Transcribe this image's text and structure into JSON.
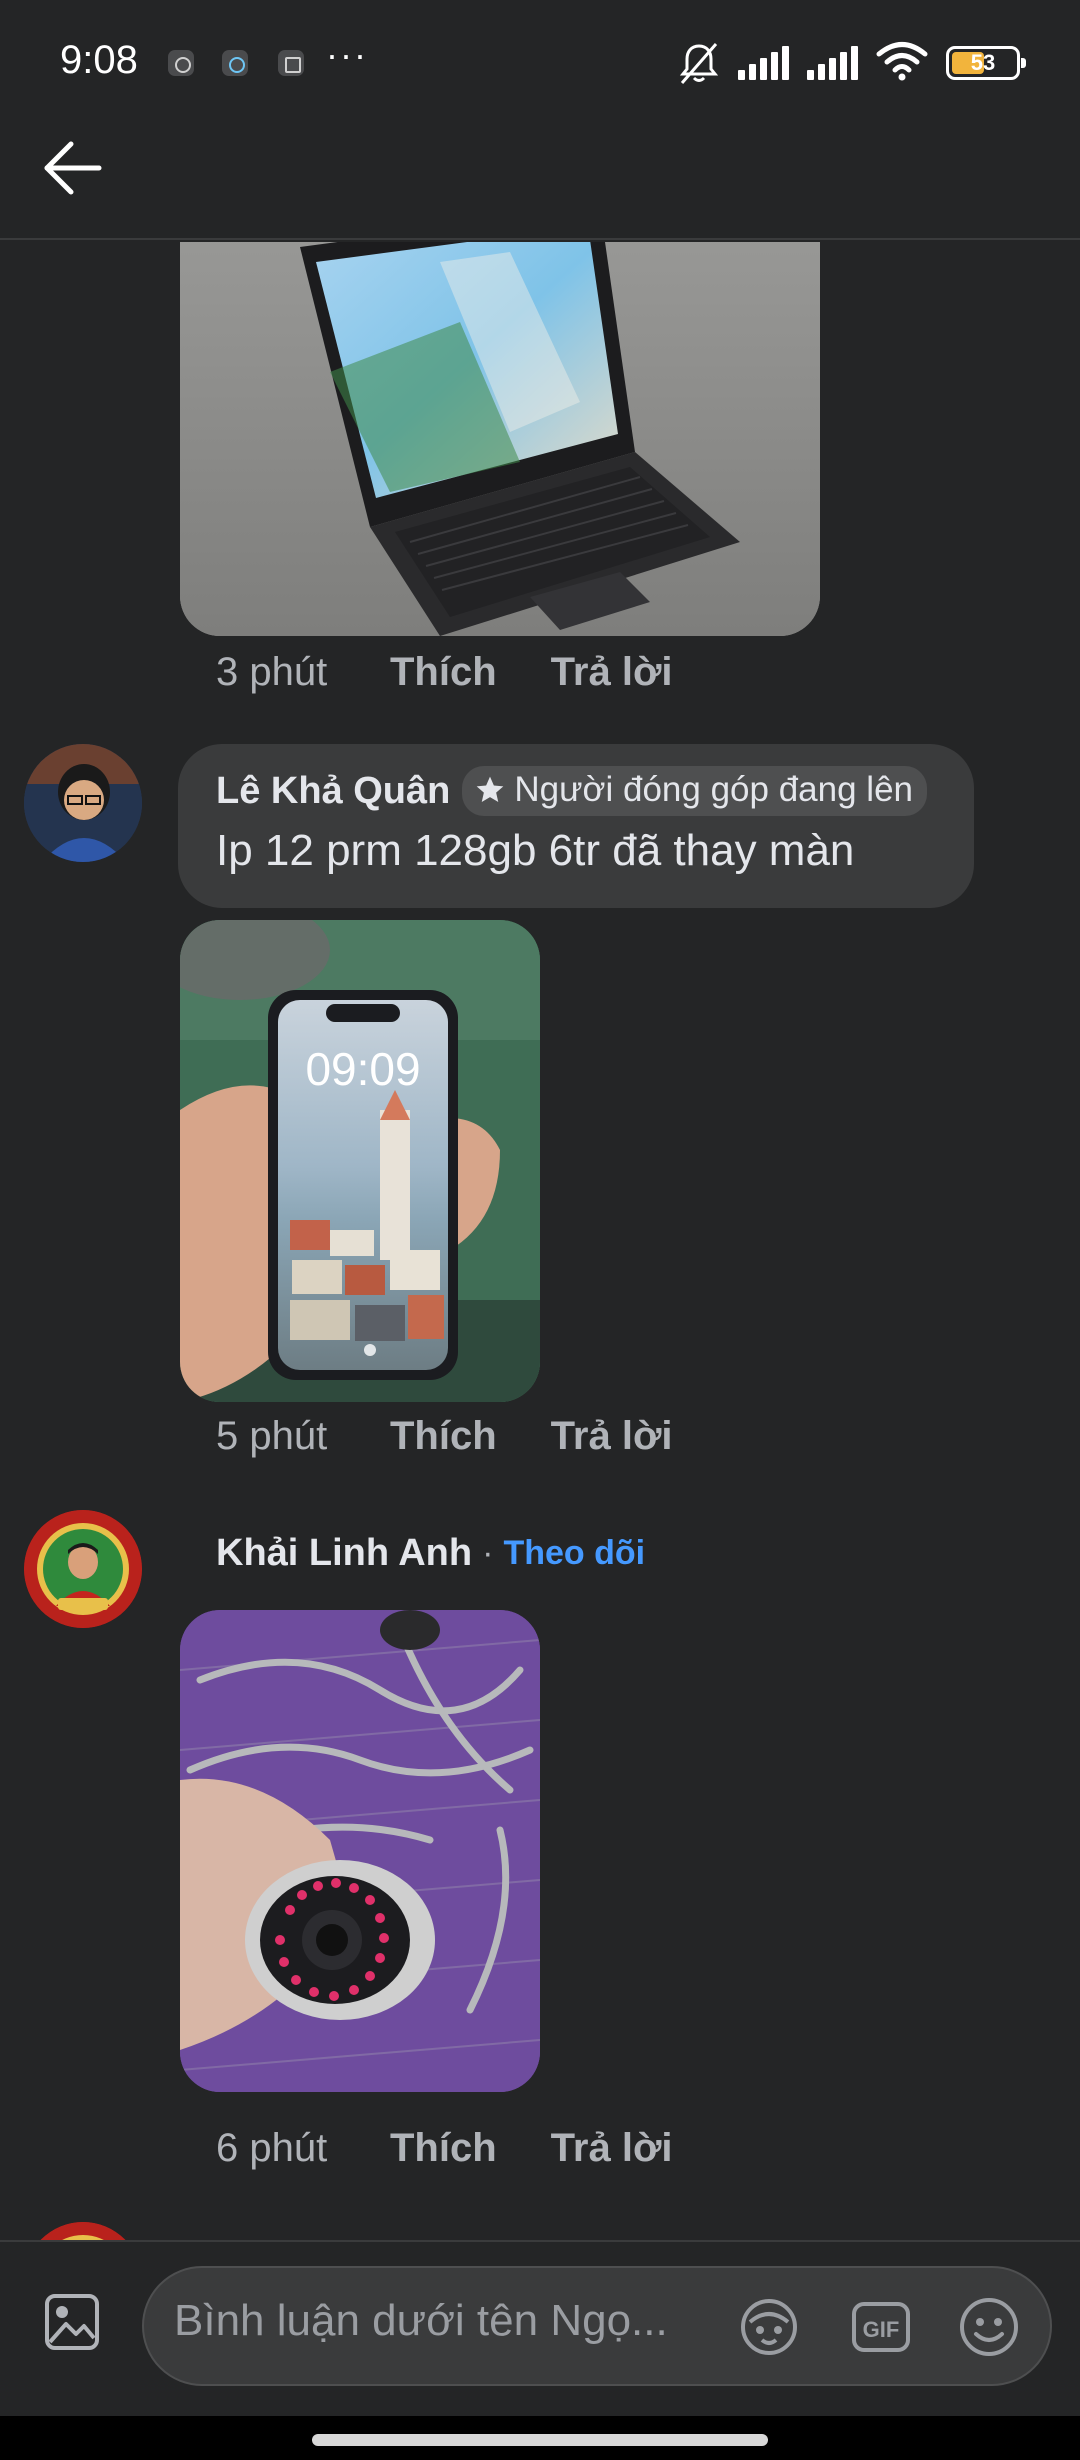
{
  "status_bar": {
    "time": "9:08",
    "dots": "···",
    "battery": "53",
    "battery_fill_percent": 53
  },
  "header": {
    "back_icon": "arrow-left-icon"
  },
  "comments": [
    {
      "image": "laptop-photo",
      "time": "3 phút",
      "like_label": "Thích",
      "reply_label": "Trả lời"
    },
    {
      "author": "Lê Khả Quân",
      "badge_icon": "star-icon",
      "badge": "Người đóng góp đang lên",
      "text": "Ip 12 prm 128gb 6tr đã thay màn",
      "image": "phone-photo",
      "phone_clock": "09:09",
      "time": "5 phút",
      "like_label": "Thích",
      "reply_label": "Trả lời"
    },
    {
      "author": "Khải Linh Anh",
      "separator": "·",
      "follow_label": "Theo dõi",
      "image": "camera-photo",
      "time": "6 phút",
      "like_label": "Thích",
      "reply_label": "Trả lời"
    }
  ],
  "composer": {
    "placeholder": "Bình luận dưới tên Ngọ...",
    "gif_label": "GIF",
    "icons": [
      "photo-icon",
      "avatar-sticker-icon",
      "gif-icon",
      "emoji-icon"
    ]
  },
  "colors": {
    "background": "#242526",
    "bubble": "#3a3b3c",
    "link": "#4599ff",
    "muted": "#b0b3b8"
  }
}
